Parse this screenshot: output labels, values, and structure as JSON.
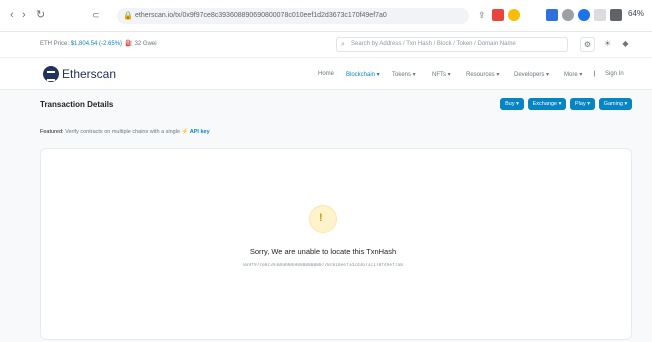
{
  "browser": {
    "back": "‹",
    "forward": "›",
    "reload": "↻",
    "url": "etherscan.io/tx/0x9f97ce8c393608890690800078c010eef1d2d3673c170f49ef7a0",
    "ext_label": "64%"
  },
  "info_bar": {
    "eth_price_label": "ETH Price:",
    "eth_price_value": "$1,804.54 (-2.65%)",
    "gas": "32 Gwei",
    "search_placeholder": "Search by Address / Txn Hash / Block / Token / Domain Name"
  },
  "header": {
    "logo_text": "Etherscan",
    "nav": [
      "Home",
      "Blockchain ▾",
      "Tokens ▾",
      "NFTs ▾",
      "Resources ▾",
      "Developers ▾",
      "More ▾",
      "Sign In"
    ]
  },
  "page": {
    "title": "Transaction Details",
    "buttons": [
      "Buy ▾",
      "Exchange ▾",
      "Play ▾",
      "Gaming ▾"
    ],
    "featured_label": "Featured:",
    "featured_text": "Verify contracts on multiple chains with a single",
    "featured_link": "API key"
  },
  "error": {
    "icon": "!",
    "title": "Sorry, We are unable to locate this TxnHash",
    "hash": "0x9f97ce8c3930689069080000000778c010eef3d2d3673c170f49ef7a0"
  },
  "colors": {
    "accent": "#0784c3",
    "brand": "#21325b"
  }
}
